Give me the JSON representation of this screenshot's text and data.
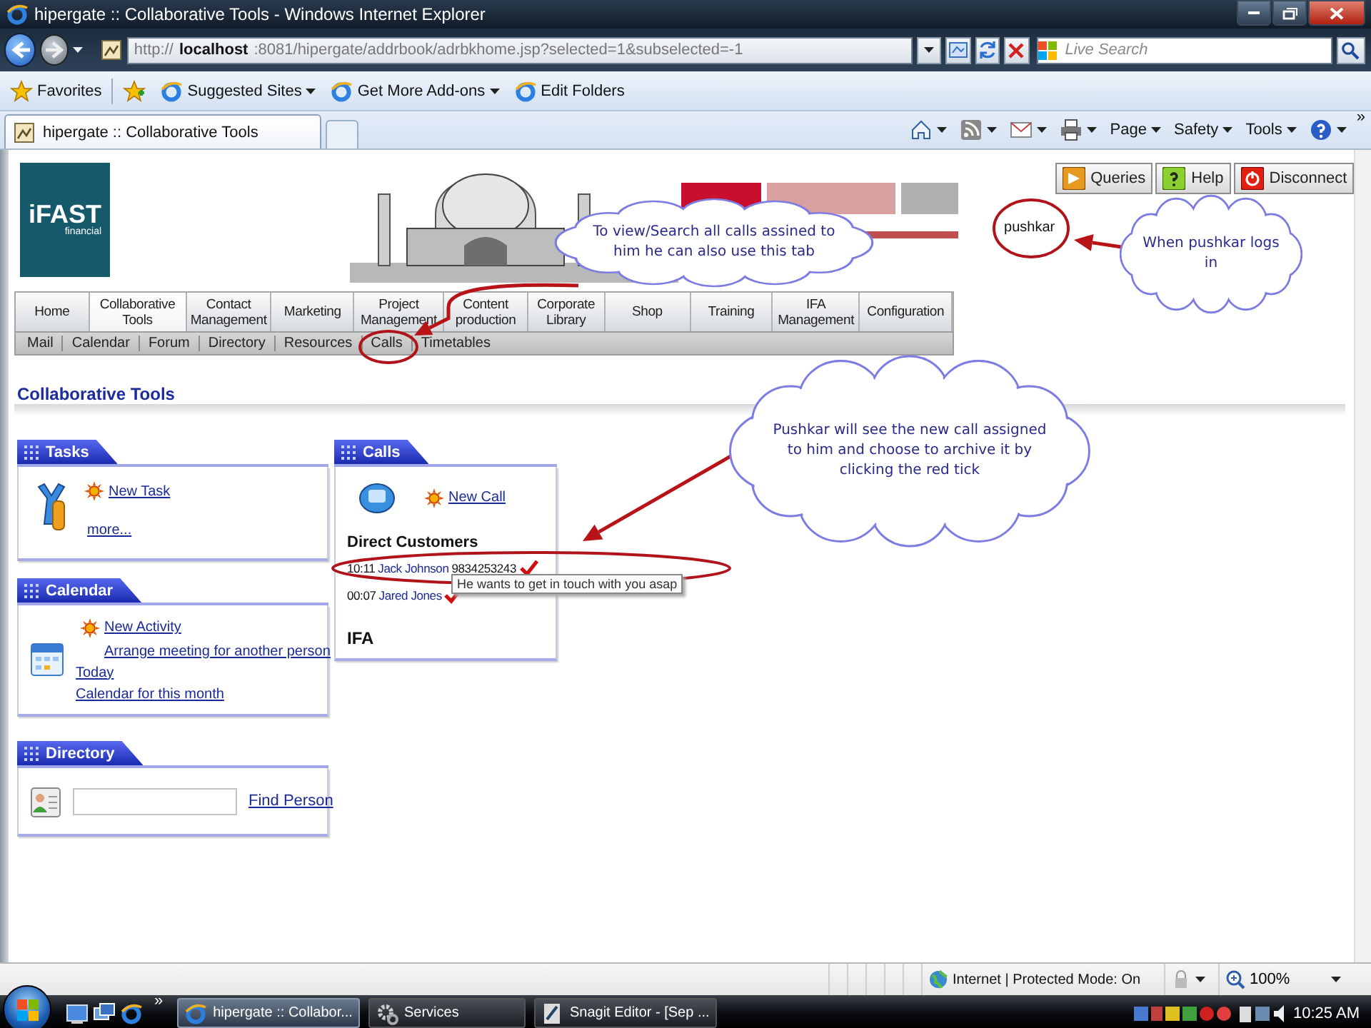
{
  "window": {
    "title": "hipergate :: Collaborative Tools - Windows Internet Explorer"
  },
  "address_bar": {
    "url": "http://**localhost**:8081/hipergate/addrbook/adrbkhome.jsp?selected=1&subselected=-1"
  },
  "search": {
    "placeholder": "Live Search"
  },
  "favorites_bar": [
    {
      "label": "Favorites",
      "kind": "favorites"
    },
    {
      "label": "Suggested Sites",
      "kind": "menu"
    },
    {
      "label": "Get More Add-ons",
      "kind": "menu"
    },
    {
      "label": "Edit Folders",
      "kind": "link"
    }
  ],
  "browser_tabs": [
    {
      "label": "hipergate :: Collaborative Tools",
      "selected": true
    }
  ],
  "command_bar": [
    "Page",
    "Safety",
    "Tools"
  ],
  "command_bar_more": "»",
  "header": {
    "logo": "iFAST",
    "logo_sub": "financial",
    "user": "pushkar",
    "buttons": [
      {
        "label": "Queries",
        "kind": "queries"
      },
      {
        "label": "Help",
        "kind": "help"
      },
      {
        "label": "Disconnect",
        "kind": "disconnect"
      }
    ]
  },
  "nav": {
    "tabs": [
      {
        "label": "Home",
        "selected": false
      },
      {
        "label": "Collaborative Tools",
        "selected": true
      },
      {
        "label": "Contact Management",
        "selected": false
      },
      {
        "label": "Marketing",
        "selected": false
      },
      {
        "label": "Project Management",
        "selected": false
      },
      {
        "label": "Content production",
        "selected": false
      },
      {
        "label": "Corporate Library",
        "selected": false
      },
      {
        "label": "Shop",
        "selected": false
      },
      {
        "label": "Training",
        "selected": false
      },
      {
        "label": "IFA Management",
        "selected": false
      },
      {
        "label": "Configuration",
        "selected": false
      }
    ],
    "subtabs": [
      "Mail",
      "Calendar",
      "Forum",
      "Directory",
      "Resources",
      "Calls",
      "Timetables"
    ]
  },
  "page_title": "Collaborative Tools",
  "tasks": {
    "title": "Tasks",
    "new_link": "New Task",
    "more_link": "more..."
  },
  "calendar": {
    "title": "Calendar",
    "new_link": "New Activity",
    "sub_link": "Arrange meeting for another person",
    "links": [
      "Today",
      "Calendar for this month"
    ]
  },
  "directory": {
    "title": "Directory",
    "button": "Find Person"
  },
  "calls": {
    "title": "Calls",
    "new_link": "New Call",
    "sections": [
      {
        "title": "Direct Customers",
        "rows": [
          {
            "time": "10:11",
            "name": "Jack Johnson",
            "phone": "9834253243"
          },
          {
            "time": "00:07",
            "name": "Jared Jones"
          }
        ]
      },
      {
        "title": "IFA"
      }
    ],
    "tooltip": "He wants to get in touch with you asap"
  },
  "annotations": [
    {
      "text": "To view/Search all calls assined to him he can also use this tab"
    },
    {
      "text": "When pushkar logs in"
    },
    {
      "text": "Pushkar will see the new call assigned to him and choose to archive it by clicking the red tick"
    }
  ],
  "status_bar": {
    "zone": "Internet | Protected Mode: On",
    "zoom": "100%"
  },
  "taskbar": {
    "more": "»",
    "buttons": [
      {
        "label": "hipergate :: Collabor...",
        "selected": true,
        "kind": "browser"
      },
      {
        "label": "Services",
        "selected": false,
        "kind": "services"
      },
      {
        "label": "Snagit Editor - [Sep ...",
        "selected": false,
        "kind": "editor"
      }
    ],
    "clock": "10:25 AM"
  }
}
